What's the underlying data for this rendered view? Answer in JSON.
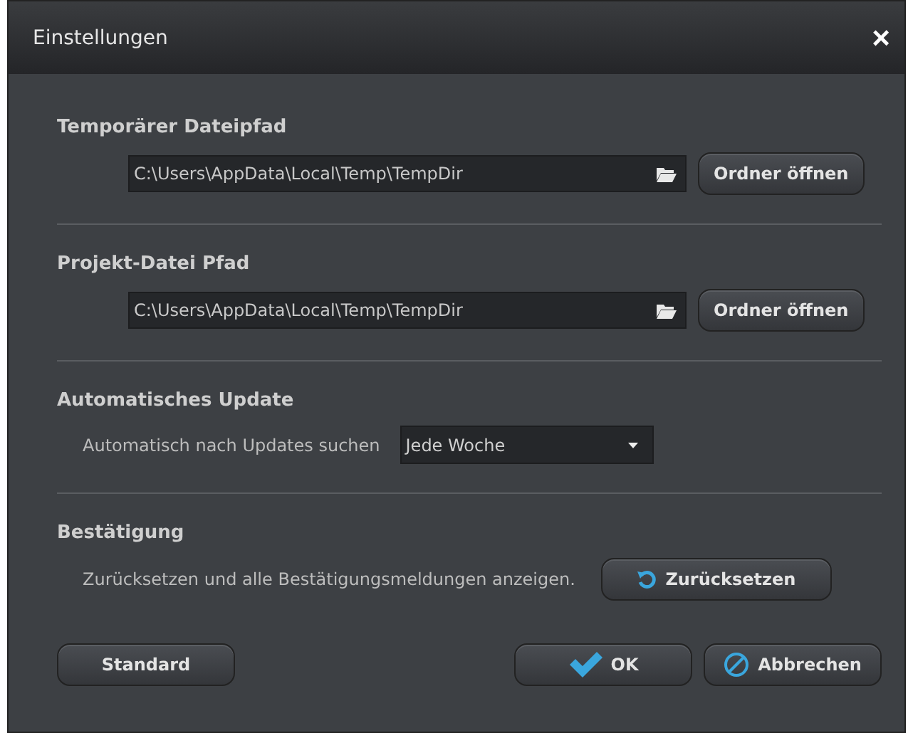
{
  "window": {
    "title": "Einstellungen",
    "close": "×"
  },
  "sections": [
    {
      "kind": "path",
      "title": "Temporärer Dateipfad",
      "value": "C:\\Users\\AppData\\Local\\Temp\\TempDir",
      "button": "Ordner öffnen"
    },
    {
      "kind": "path",
      "title": "Projekt-Datei Pfad",
      "value": "C:\\Users\\AppData\\Local\\Temp\\TempDir",
      "button": "Ordner öffnen"
    },
    {
      "kind": "dropdown",
      "title": "Automatisches Update",
      "label": "Automatisch nach Updates suchen",
      "value": "Jede Woche"
    },
    {
      "kind": "reset",
      "title": "Bestätigung",
      "label": "Zurücksetzen und alle Bestätigungsmeldungen anzeigen.",
      "button": "Zurücksetzen"
    }
  ],
  "footer": {
    "default_button": "Standard",
    "ok_button": "OK",
    "cancel_button": "Abbrechen"
  }
}
